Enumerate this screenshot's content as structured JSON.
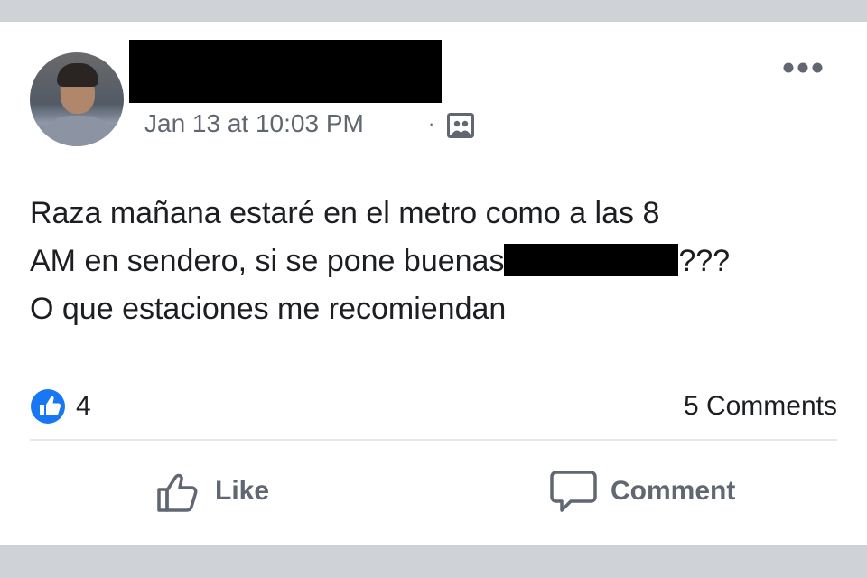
{
  "post": {
    "timestamp": "Jan 13 at 10:03 PM",
    "separator": "·",
    "audience_icon": "audience-icon",
    "text_lines": {
      "line1": "Raza mañana estaré en el metro como a las 8",
      "line2_before": "AM en sendero, si se pone buenas",
      "line2_after": "???",
      "line3": "O que estaciones me recomiendan"
    },
    "reactions": {
      "icon": "like-reaction-icon",
      "count": "4"
    },
    "comments_count": "5 Comments"
  },
  "actions": {
    "like_label": "Like",
    "comment_label": "Comment"
  },
  "colors": {
    "facebook_blue": "#1877f2",
    "secondary_text": "#616770",
    "band_gray": "#cfd2d6"
  }
}
